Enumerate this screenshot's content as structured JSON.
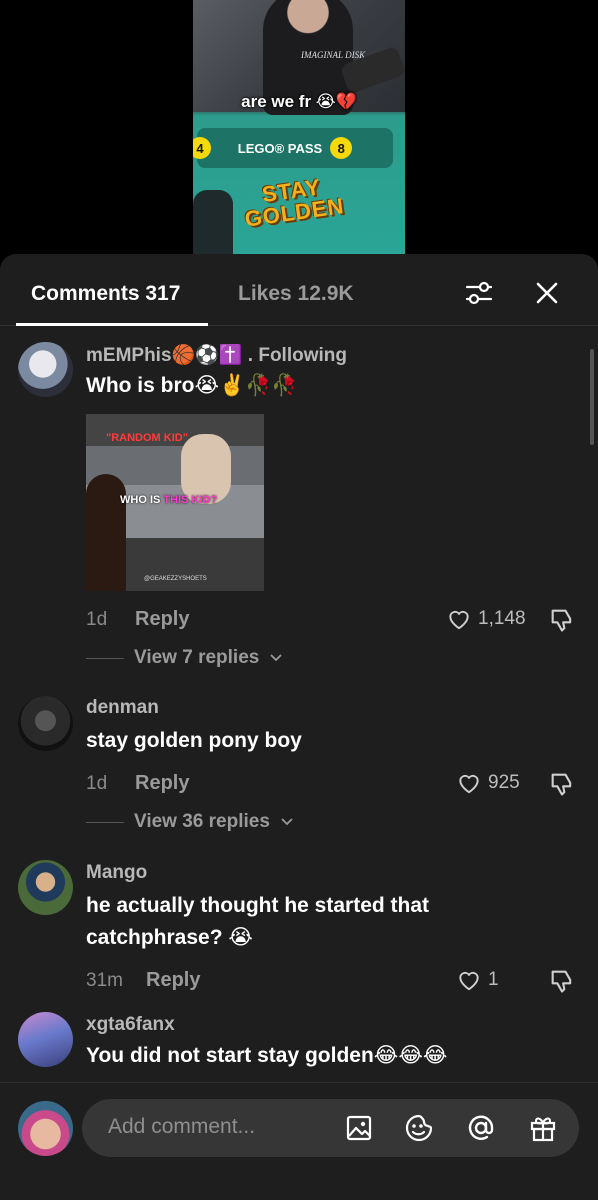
{
  "video": {
    "caption": "are we fr 😭💔",
    "shirt_text": "IMAGINAL DISK",
    "pass_left_badge": "4",
    "pass_label": "LEGO® PASS",
    "pass_badge": "8",
    "golden_line1": "STAY",
    "golden_line2": "GOLDEN"
  },
  "tabs": {
    "comments": "Comments 317",
    "likes": "Likes 12.9K"
  },
  "comments": [
    {
      "username": "mEMPhis🏀⚽✝️",
      "following": ". Following",
      "text": "Who is bro😭✌️🥀🥀",
      "time": "1d",
      "reply": "Reply",
      "likes": "1,148",
      "view_replies": "View 7 replies",
      "image": {
        "label_top": "\"RANDOM KID\"",
        "label_who": "WHO IS ",
        "label_hl": "THIS KID?",
        "watermark": "@GEAKEZZYSHOETS"
      }
    },
    {
      "username": "denman",
      "text": "stay golden pony boy",
      "time": "1d",
      "reply": "Reply",
      "likes": "925",
      "view_replies": "View 36 replies"
    },
    {
      "username": "Mango",
      "text": "he actually thought he started that catchphrase? 😭",
      "time": "31m",
      "reply": "Reply",
      "likes": "1"
    },
    {
      "username": "xgta6fanx",
      "text": "You did not start stay golden😂😂😂"
    }
  ],
  "input": {
    "placeholder": "Add comment..."
  },
  "icons": {
    "filter": "sliders-icon",
    "close": "close-icon",
    "like": "heart-icon",
    "dislike": "thumbs-down-icon",
    "image": "image-icon",
    "emoji": "emoji-icon",
    "mention": "at-icon",
    "gift": "gift-icon"
  }
}
